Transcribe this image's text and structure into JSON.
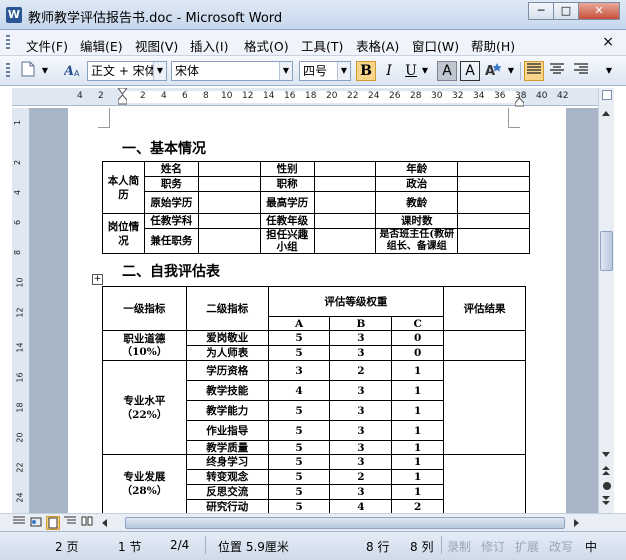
{
  "window": {
    "title": "教师教学评估报告书.doc - Microsoft Word",
    "app_icon": "W",
    "min": "─",
    "max": "□",
    "close": "✕"
  },
  "menu": [
    {
      "label": "文件(F)"
    },
    {
      "label": "编辑(E)"
    },
    {
      "label": "视图(V)"
    },
    {
      "label": "插入(I)"
    },
    {
      "label": "格式(O)"
    },
    {
      "label": "工具(T)"
    },
    {
      "label": "表格(A)"
    },
    {
      "label": "窗口(W)"
    },
    {
      "label": "帮助(H)"
    }
  ],
  "menu_close": "×",
  "toolbar": {
    "style": "正文 + 宋体",
    "font": "宋体",
    "size": "四号",
    "bold": "B",
    "italic": "I",
    "underline": "U",
    "font_color_a": "A",
    "char_border": "A",
    "dropdown": "▼"
  },
  "ruler": [
    "4",
    "2",
    "2",
    "4",
    "6",
    "8",
    "10",
    "12",
    "14",
    "16",
    "18",
    "20",
    "22",
    "24",
    "26",
    "28",
    "30",
    "32",
    "34",
    "36",
    "38",
    "40",
    "42"
  ],
  "vruler": [
    "1",
    "2",
    "4",
    "6",
    "8",
    "10",
    "12",
    "14",
    "16",
    "18",
    "20",
    "22",
    "24"
  ],
  "doc": {
    "heading1": "一、基本情况",
    "heading2": "二、自我评估表",
    "basic": {
      "row_group1": "本人简历",
      "row_group2": "岗位情况",
      "cells": [
        [
          "姓名",
          "性别",
          "年龄"
        ],
        [
          "职务",
          "职称",
          "政治"
        ],
        [
          "原始学历",
          "最高学历",
          "教龄"
        ],
        [
          "任教学科",
          "任教年级",
          "课时数"
        ],
        [
          "兼任职务",
          "担任兴趣小组",
          "是否班主任(教研组长、备课组"
        ]
      ]
    },
    "eval": {
      "col1": "一级指标",
      "col2": "二级指标",
      "col3": "评估等级权重",
      "col4": "评估结果",
      "grades": [
        "A",
        "B",
        "C"
      ],
      "groups": [
        {
          "name": "职业道德",
          "weight": "（10%）",
          "rows": [
            {
              "item": "爱岗敬业",
              "a": "5",
              "b": "3",
              "c": "0"
            },
            {
              "item": "为人师表",
              "a": "5",
              "b": "3",
              "c": "0"
            }
          ]
        },
        {
          "name": "专业水平",
          "weight": "（22%）",
          "rows": [
            {
              "item": "学历资格",
              "a": "3",
              "b": "2",
              "c": "1"
            },
            {
              "item": "教学技能",
              "a": "4",
              "b": "3",
              "c": "1"
            },
            {
              "item": "教学能力",
              "a": "5",
              "b": "3",
              "c": "1"
            },
            {
              "item": "作业指导",
              "a": "5",
              "b": "3",
              "c": "1"
            },
            {
              "item": "教学质量",
              "a": "5",
              "b": "3",
              "c": "1"
            }
          ]
        },
        {
          "name": "专业发展",
          "weight": "（28%）",
          "rows": [
            {
              "item": "终身学习",
              "a": "5",
              "b": "3",
              "c": "1"
            },
            {
              "item": "转变观念",
              "a": "5",
              "b": "2",
              "c": "1"
            },
            {
              "item": "反思交流",
              "a": "5",
              "b": "3",
              "c": "1"
            },
            {
              "item": "研究行动",
              "a": "5",
              "b": "4",
              "c": "2"
            }
          ]
        }
      ]
    }
  },
  "status": {
    "page": "2 页",
    "section": "1 节",
    "pages": "2/4",
    "position": "位置 5.9厘米",
    "line": "8 行",
    "col": "8 列",
    "rec": "录制",
    "trk": "修订",
    "ext": "扩展",
    "ovr": "改写",
    "lang": "中"
  }
}
